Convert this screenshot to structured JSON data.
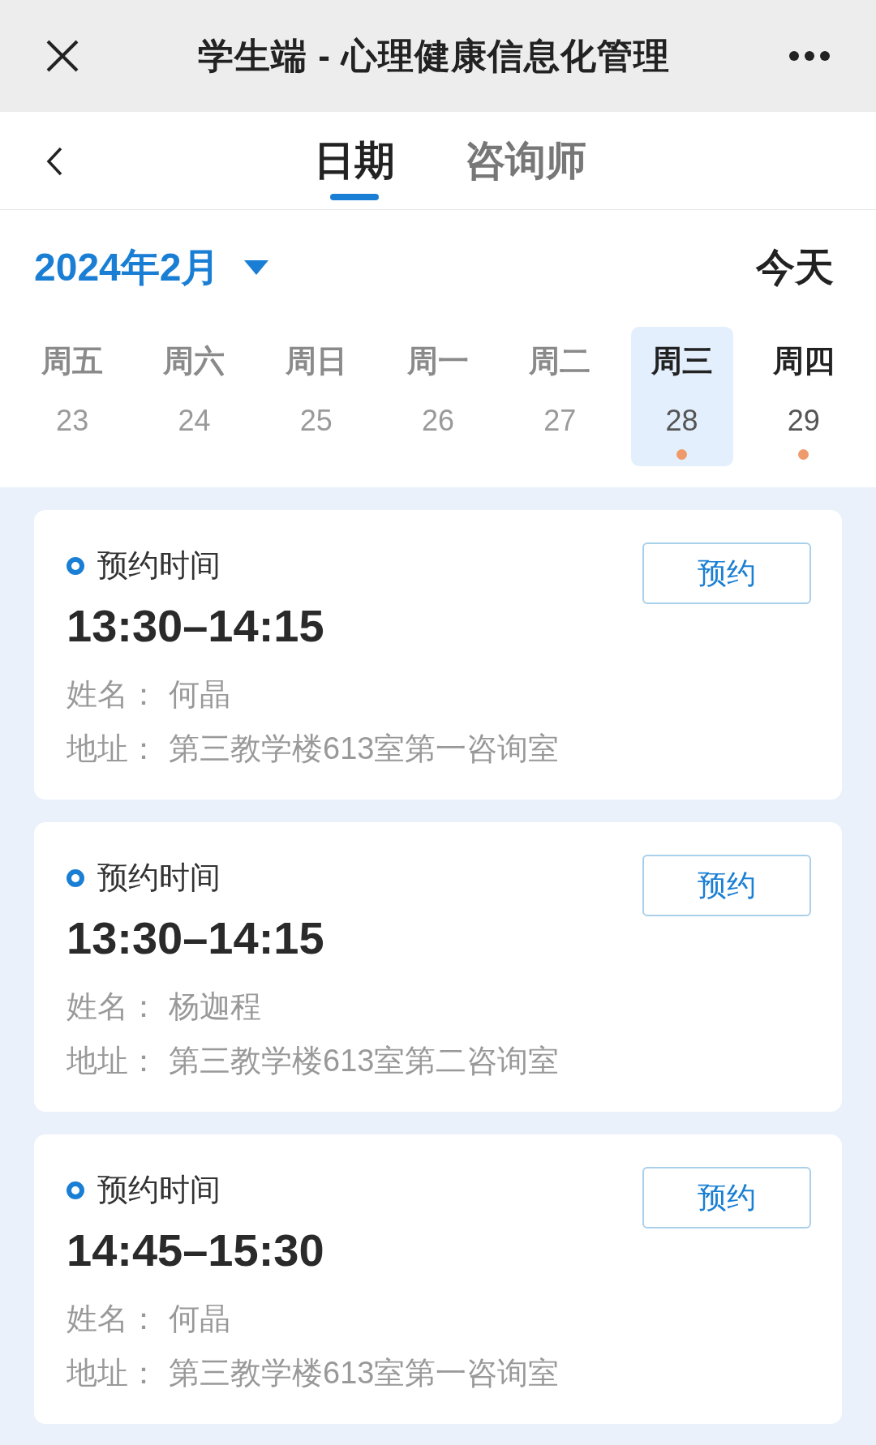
{
  "window": {
    "title": "学生端 - 心理健康信息化管理"
  },
  "tabs": [
    {
      "label": "日期",
      "selected": true
    },
    {
      "label": "咨询师",
      "selected": false
    }
  ],
  "month": {
    "label": "2024年2月",
    "today_button": "今天"
  },
  "week": [
    {
      "weekday": "周五",
      "date": "23",
      "past": true,
      "has_slots": false,
      "selected": false
    },
    {
      "weekday": "周六",
      "date": "24",
      "past": true,
      "has_slots": false,
      "selected": false
    },
    {
      "weekday": "周日",
      "date": "25",
      "past": true,
      "has_slots": false,
      "selected": false
    },
    {
      "weekday": "周一",
      "date": "26",
      "past": true,
      "has_slots": false,
      "selected": false
    },
    {
      "weekday": "周二",
      "date": "27",
      "past": true,
      "has_slots": false,
      "selected": false
    },
    {
      "weekday": "周三",
      "date": "28",
      "past": false,
      "has_slots": true,
      "selected": true
    },
    {
      "weekday": "周四",
      "date": "29",
      "past": false,
      "has_slots": true,
      "selected": false
    }
  ],
  "slots": [
    {
      "heading": "预约时间",
      "time": "13:30–14:15",
      "name_label": "姓名：",
      "name": "何晶",
      "address_label": "地址：",
      "address": "第三教学楼613室第一咨询室",
      "button": "预约"
    },
    {
      "heading": "预约时间",
      "time": "13:30–14:15",
      "name_label": "姓名：",
      "name": "杨迦程",
      "address_label": "地址：",
      "address": "第三教学楼613室第二咨询室",
      "button": "预约"
    },
    {
      "heading": "预约时间",
      "time": "14:45–15:30",
      "name_label": "姓名：",
      "name": "何晶",
      "address_label": "地址：",
      "address": "第三教学楼613室第一咨询室",
      "button": "预约"
    }
  ]
}
